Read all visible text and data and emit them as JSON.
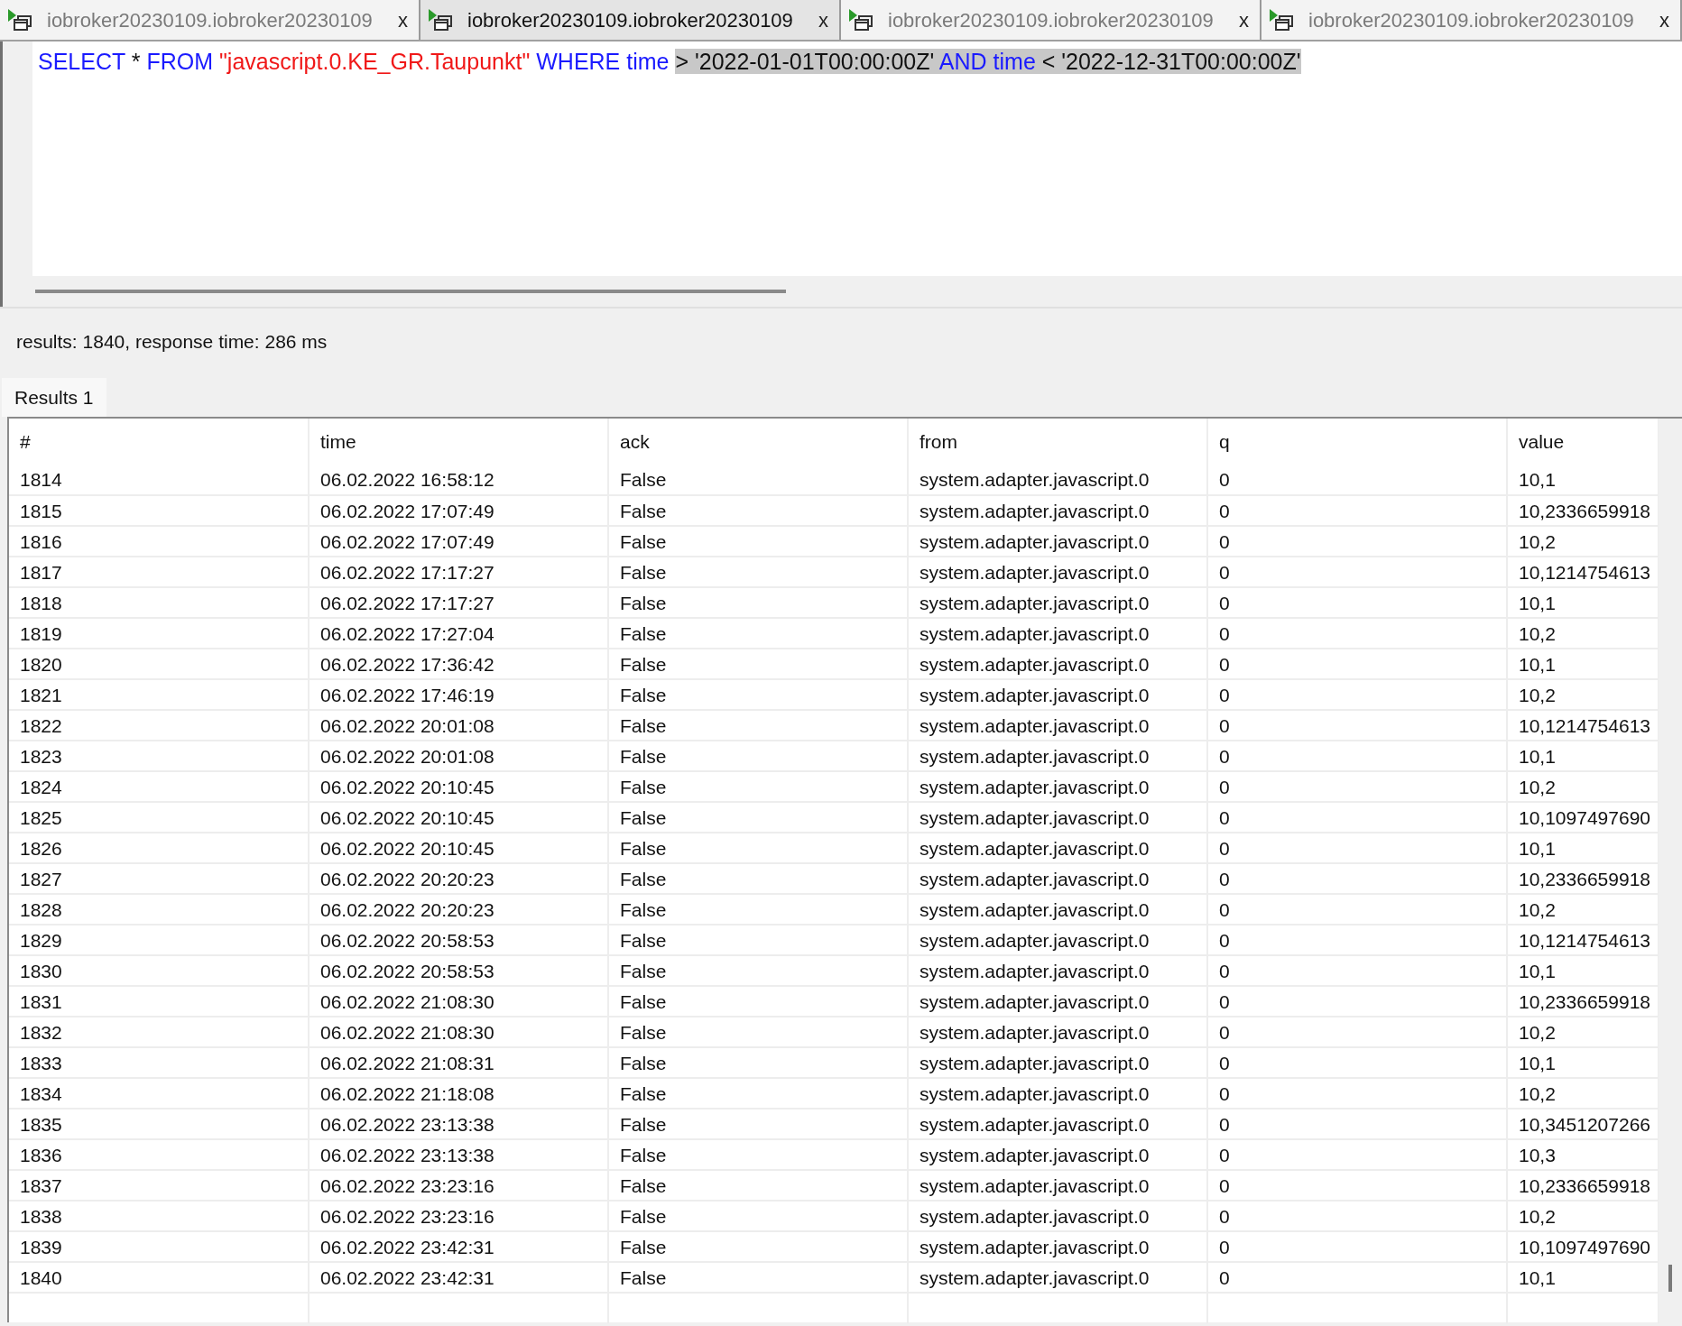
{
  "tabs": [
    {
      "label": "iobroker20230109.iobroker20230109",
      "close": "x",
      "selected": false
    },
    {
      "label": "iobroker20230109.iobroker20230109",
      "close": "x",
      "selected": true
    },
    {
      "label": "iobroker20230109.iobroker20230109",
      "close": "x",
      "selected": false
    },
    {
      "label": "iobroker20230109.iobroker20230109",
      "close": "x",
      "selected": false
    }
  ],
  "editor": {
    "query": [
      {
        "text": "SELECT",
        "kind": "keyword",
        "highlighted": false
      },
      {
        "text": " * ",
        "kind": "plain",
        "highlighted": false
      },
      {
        "text": "FROM ",
        "kind": "keyword",
        "highlighted": false
      },
      {
        "text": "\"javascript.0.KE_GR.Taupunkt\"",
        "kind": "string",
        "highlighted": false
      },
      {
        "text": " WHERE time ",
        "kind": "keyword",
        "highlighted": false
      },
      {
        "text": "> '2022-01-01T00:00:00Z' ",
        "kind": "plain",
        "highlighted": true
      },
      {
        "text": "AND time",
        "kind": "keyword",
        "highlighted": true
      },
      {
        "text": " < '2022-12-31T00:00:00Z'",
        "kind": "plain",
        "highlighted": true
      }
    ]
  },
  "status": "results: 1840, response time: 286 ms",
  "result_tabs": [
    {
      "label": "Results 1",
      "selected": true
    }
  ],
  "table": {
    "columns": [
      "#",
      "time",
      "ack",
      "from",
      "q",
      "value"
    ],
    "rows": [
      [
        "1814",
        "06.02.2022 16:58:12",
        "False",
        "system.adapter.javascript.0",
        "0",
        "10,1"
      ],
      [
        "1815",
        "06.02.2022 17:07:49",
        "False",
        "system.adapter.javascript.0",
        "0",
        "10,2336659918"
      ],
      [
        "1816",
        "06.02.2022 17:07:49",
        "False",
        "system.adapter.javascript.0",
        "0",
        "10,2"
      ],
      [
        "1817",
        "06.02.2022 17:17:27",
        "False",
        "system.adapter.javascript.0",
        "0",
        "10,1214754613"
      ],
      [
        "1818",
        "06.02.2022 17:17:27",
        "False",
        "system.adapter.javascript.0",
        "0",
        "10,1"
      ],
      [
        "1819",
        "06.02.2022 17:27:04",
        "False",
        "system.adapter.javascript.0",
        "0",
        "10,2"
      ],
      [
        "1820",
        "06.02.2022 17:36:42",
        "False",
        "system.adapter.javascript.0",
        "0",
        "10,1"
      ],
      [
        "1821",
        "06.02.2022 17:46:19",
        "False",
        "system.adapter.javascript.0",
        "0",
        "10,2"
      ],
      [
        "1822",
        "06.02.2022 20:01:08",
        "False",
        "system.adapter.javascript.0",
        "0",
        "10,1214754613"
      ],
      [
        "1823",
        "06.02.2022 20:01:08",
        "False",
        "system.adapter.javascript.0",
        "0",
        "10,1"
      ],
      [
        "1824",
        "06.02.2022 20:10:45",
        "False",
        "system.adapter.javascript.0",
        "0",
        "10,2"
      ],
      [
        "1825",
        "06.02.2022 20:10:45",
        "False",
        "system.adapter.javascript.0",
        "0",
        "10,1097497690"
      ],
      [
        "1826",
        "06.02.2022 20:10:45",
        "False",
        "system.adapter.javascript.0",
        "0",
        "10,1"
      ],
      [
        "1827",
        "06.02.2022 20:20:23",
        "False",
        "system.adapter.javascript.0",
        "0",
        "10,2336659918"
      ],
      [
        "1828",
        "06.02.2022 20:20:23",
        "False",
        "system.adapter.javascript.0",
        "0",
        "10,2"
      ],
      [
        "1829",
        "06.02.2022 20:58:53",
        "False",
        "system.adapter.javascript.0",
        "0",
        "10,1214754613"
      ],
      [
        "1830",
        "06.02.2022 20:58:53",
        "False",
        "system.adapter.javascript.0",
        "0",
        "10,1"
      ],
      [
        "1831",
        "06.02.2022 21:08:30",
        "False",
        "system.adapter.javascript.0",
        "0",
        "10,2336659918"
      ],
      [
        "1832",
        "06.02.2022 21:08:30",
        "False",
        "system.adapter.javascript.0",
        "0",
        "10,2"
      ],
      [
        "1833",
        "06.02.2022 21:08:31",
        "False",
        "system.adapter.javascript.0",
        "0",
        "10,1"
      ],
      [
        "1834",
        "06.02.2022 21:18:08",
        "False",
        "system.adapter.javascript.0",
        "0",
        "10,2"
      ],
      [
        "1835",
        "06.02.2022 23:13:38",
        "False",
        "system.adapter.javascript.0",
        "0",
        "10,3451207266"
      ],
      [
        "1836",
        "06.02.2022 23:13:38",
        "False",
        "system.adapter.javascript.0",
        "0",
        "10,3"
      ],
      [
        "1837",
        "06.02.2022 23:23:16",
        "False",
        "system.adapter.javascript.0",
        "0",
        "10,2336659918"
      ],
      [
        "1838",
        "06.02.2022 23:23:16",
        "False",
        "system.adapter.javascript.0",
        "0",
        "10,2"
      ],
      [
        "1839",
        "06.02.2022 23:42:31",
        "False",
        "system.adapter.javascript.0",
        "0",
        "10,1097497690"
      ],
      [
        "1840",
        "06.02.2022 23:42:31",
        "False",
        "system.adapter.javascript.0",
        "0",
        "10,1"
      ]
    ]
  }
}
